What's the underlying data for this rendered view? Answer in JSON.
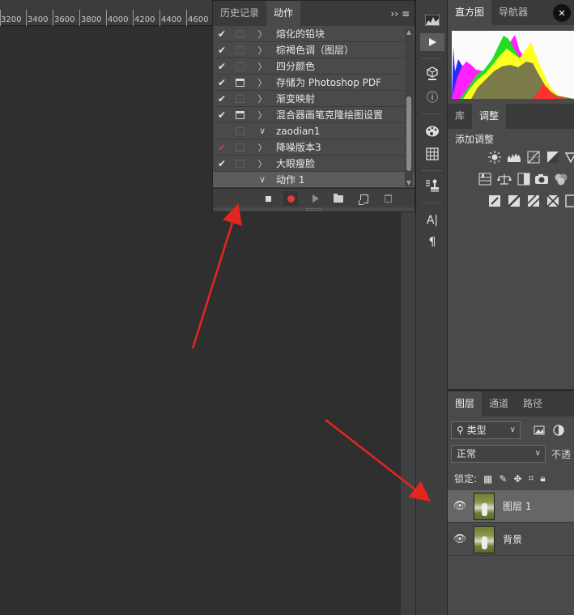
{
  "ruler": {
    "ticks": [
      "3200",
      "3400",
      "3600",
      "3800",
      "4000",
      "4200",
      "4400",
      "4600"
    ]
  },
  "actions_panel": {
    "tabs": [
      "历史记录",
      "动作"
    ],
    "menu_glyphs": "›› ≡",
    "items": [
      {
        "check": "✔",
        "check_color": "white",
        "dialog": false,
        "toggle": "〉",
        "name": "熔化的铅块"
      },
      {
        "check": "✔",
        "check_color": "white",
        "dialog": false,
        "toggle": "〉",
        "name": "棕褐色调（图层）"
      },
      {
        "check": "✔",
        "check_color": "white",
        "dialog": false,
        "toggle": "〉",
        "name": "四分颜色"
      },
      {
        "check": "✔",
        "check_color": "white",
        "dialog": true,
        "toggle": "〉",
        "name": "存储为 Photoshop PDF"
      },
      {
        "check": "✔",
        "check_color": "white",
        "dialog": false,
        "toggle": "〉",
        "name": "渐变映射"
      },
      {
        "check": "✔",
        "check_color": "white",
        "dialog": true,
        "toggle": "〉",
        "name": "混合器画笔克隆绘图设置"
      },
      {
        "check": "",
        "check_color": "white",
        "dialog": false,
        "toggle": "∨",
        "name": "zaodian1"
      },
      {
        "check": "✔",
        "check_color": "red",
        "dialog": false,
        "toggle": "〉",
        "name": "降噪版本3"
      },
      {
        "check": "✔",
        "check_color": "white",
        "dialog": false,
        "toggle": "〉",
        "name": "大眼瘦脸"
      },
      {
        "check": "",
        "check_color": "white",
        "dialog": false,
        "toggle": "∨",
        "name": "动作 1"
      }
    ],
    "toolbar_buttons": [
      "stop",
      "record",
      "play",
      "new-set",
      "new-action",
      "delete"
    ]
  },
  "tool_column": {
    "icons": [
      "histogram-mini-icon",
      "play-icon",
      "3d-cube-icon",
      "info-icon",
      "palette-icon",
      "grid-icon",
      "stamp-icon",
      "type-icon",
      "paragraph-icon"
    ],
    "type_glyph": "A|",
    "paragraph_glyph": "¶",
    "info_glyph": "ⓘ"
  },
  "histogram_panel": {
    "tabs": [
      "直方图",
      "导航器"
    ],
    "close_glyph": "✕"
  },
  "adjustments_panel": {
    "tabs": [
      "库",
      "调整"
    ],
    "add_label": "添加调整"
  },
  "layers_panel": {
    "tabs": [
      "图层",
      "通道",
      "路径"
    ],
    "filter_value": "类型",
    "blend_mode": "正常",
    "opacity_label": "不透",
    "lock_label": "锁定:",
    "layers": [
      {
        "name": "图层 1",
        "selected": true
      },
      {
        "name": "背景",
        "selected": false
      }
    ]
  }
}
